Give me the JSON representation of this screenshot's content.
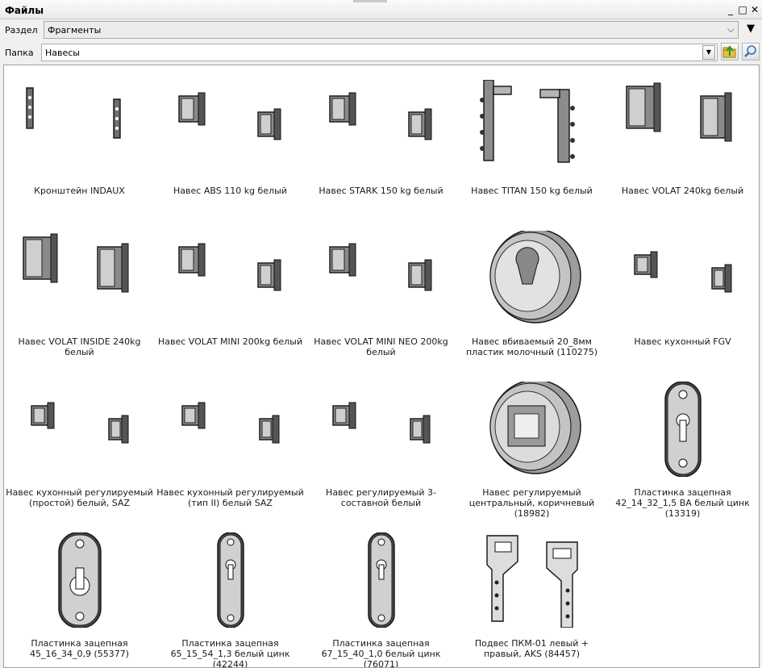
{
  "panel": {
    "title": "Файлы",
    "minimize": "_",
    "maximize": "□",
    "close": "✕"
  },
  "section": {
    "label": "Раздел",
    "value": "Фрагменты",
    "arrow": "▼"
  },
  "folder": {
    "label": "Папка",
    "value": "Навесы"
  },
  "items": [
    {
      "caption": "Кронштейн INDAUX",
      "icon": "bracket-pair"
    },
    {
      "caption": "Навес ABS 110 kg белый",
      "icon": "hinge-pair"
    },
    {
      "caption": "Навес STARK 150 kg белый",
      "icon": "hinge-pair"
    },
    {
      "caption": "Навес TITAN 150 kg белый",
      "icon": "tall-bracket-pair"
    },
    {
      "caption": "Навес VOLAT 240kg белый",
      "icon": "hinge-pair-large"
    },
    {
      "caption": "Навес VOLAT INSIDE 240kg белый",
      "icon": "hinge-pair-large"
    },
    {
      "caption": "Навес VOLAT MINI 200kg белый",
      "icon": "hinge-pair"
    },
    {
      "caption": "Навес VOLAT MINI NEO 200kg белый",
      "icon": "hinge-pair"
    },
    {
      "caption": "Навес вбиваемый 20_8мм пластик молочный (110275)",
      "icon": "round-socket"
    },
    {
      "caption": "Навес кухонный FGV",
      "icon": "hinge-pair-small"
    },
    {
      "caption": "Навес кухонный регулируемый (простой) белый, SAZ",
      "icon": "hinge-pair-small"
    },
    {
      "caption": "Навес кухонный регулируемый (тип II) белый SAZ",
      "icon": "hinge-pair-small"
    },
    {
      "caption": "Навес регулируемый 3-составной белый",
      "icon": "hinge-pair-small"
    },
    {
      "caption": "Навес регулируемый центральный, коричневый (18982)",
      "icon": "round-socket-open"
    },
    {
      "caption": "Пластинка зацепная 42_14_32_1,5 BA белый цинк (13319)",
      "icon": "keyhole-plate"
    },
    {
      "caption": "Пластинка зацепная 45_16_34_0,9 (55377)",
      "icon": "keyhole-plate-wide"
    },
    {
      "caption": "Пластинка зацепная 65_15_54_1,3 белый цинк (42244)",
      "icon": "keyhole-plate-narrow"
    },
    {
      "caption": "Пластинка зацепная 67_15_40_1,0 белый цинк (76071)",
      "icon": "keyhole-plate-narrow"
    },
    {
      "caption": "Подвес ПКМ-01 левый + правый, AKS (84457)",
      "icon": "hanger-pair"
    }
  ]
}
